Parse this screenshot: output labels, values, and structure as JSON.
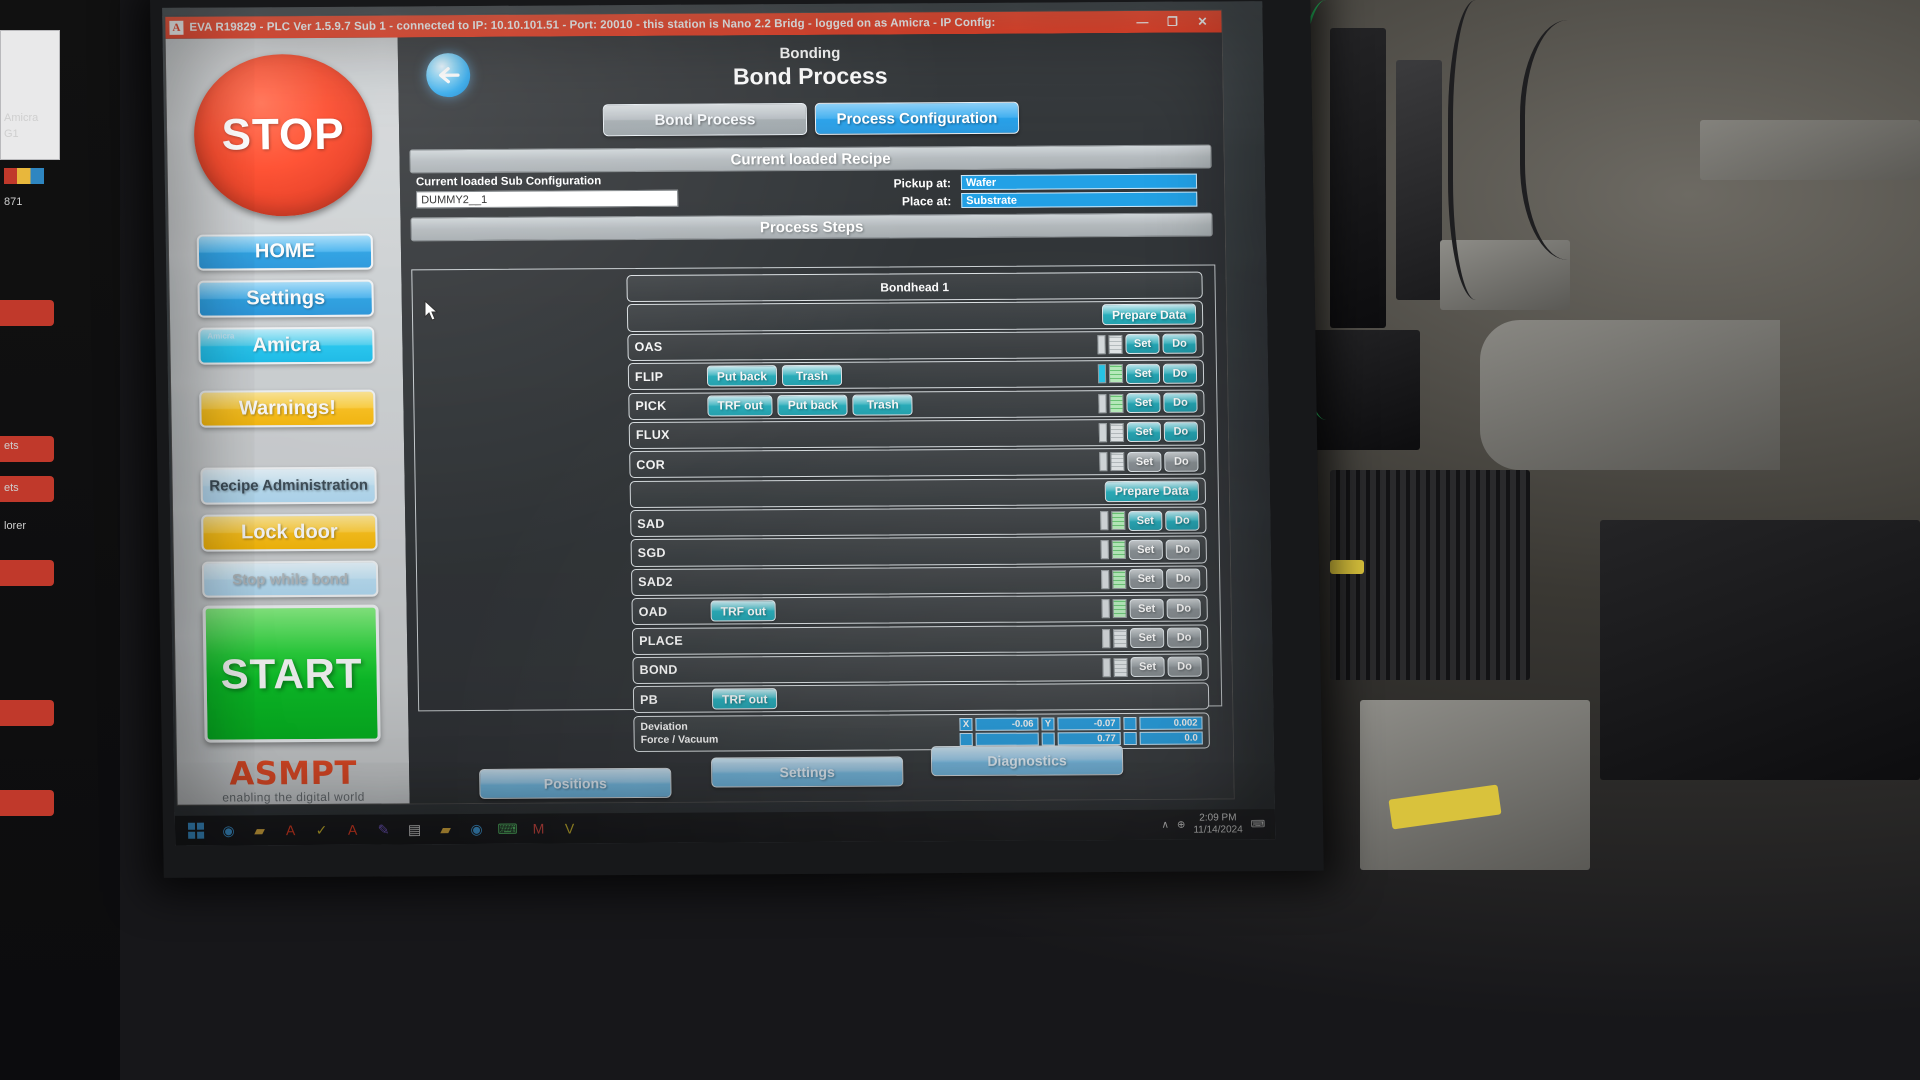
{
  "window": {
    "logo": "A",
    "title": "EVA R19829 - PLC Ver 1.5.9.7 Sub 1 - connected to IP: 10.10.101.51 - Port: 20010 - this station is Nano 2.2 Bridg - logged on as Amicra - IP Config:",
    "minimize": "—",
    "maximize": "❐",
    "close": "✕"
  },
  "sidebar": {
    "stop_label": "STOP",
    "start_label": "START",
    "buttons": [
      {
        "label": "HOME",
        "style": "b-blue",
        "tag": ""
      },
      {
        "label": "Settings",
        "style": "b-blue",
        "tag": ""
      },
      {
        "label": "Amicra",
        "style": "b-cyan",
        "tag": "Amicra"
      },
      {
        "label": "Warnings!",
        "style": "b-amber",
        "tag": ""
      },
      {
        "label": "Recipe Administration",
        "style": "b-pale",
        "tag": ""
      },
      {
        "label": "Lock door",
        "style": "b-amber",
        "tag": ""
      }
    ],
    "stop_while_label": "Stop while bond",
    "brand_name": "ASMPT",
    "brand_sub": "enabling the digital world"
  },
  "header": {
    "back_icon": "back-arrow-icon",
    "subtitle": "Bonding",
    "title": "Bond Process"
  },
  "tabs": [
    {
      "label": "Bond Process",
      "active": false
    },
    {
      "label": "Process Configuration",
      "active": true
    }
  ],
  "recipe": {
    "bar_title": "Current loaded Recipe",
    "sub_config_label": "Current loaded Sub Configuration",
    "sub_config_value": "DUMMY2__1",
    "pickup_label": "Pickup at:",
    "pickup_value": "Wafer",
    "place_label": "Place at:",
    "place_value": "Substrate"
  },
  "steps_panel": {
    "bar_title": "Process Steps",
    "bondhead_label": "Bondhead 1"
  },
  "steps": [
    {
      "name": "",
      "mid": [
        {
          "label": "Prepare Data",
          "wide": true
        }
      ],
      "slim": false,
      "grid": false,
      "set": "",
      "do": "",
      "set_style": "",
      "do_style": "",
      "controls": false
    },
    {
      "name": "OAS",
      "mid": [],
      "slim": true,
      "grid": true,
      "grid_green": false,
      "set": "Set",
      "do": "Do",
      "set_style": "sd-teal",
      "do_style": "sd-teal",
      "controls": true
    },
    {
      "name": "FLIP",
      "mid": [
        {
          "label": "Put back"
        },
        {
          "label": "Trash"
        }
      ],
      "slim": true,
      "slim_on": true,
      "grid": true,
      "grid_green": true,
      "set": "Set",
      "do": "Do",
      "set_style": "sd-teal",
      "do_style": "sd-teal",
      "controls": true
    },
    {
      "name": "PICK",
      "mid": [
        {
          "label": "TRF out"
        },
        {
          "label": "Put back"
        },
        {
          "label": "Trash"
        }
      ],
      "slim": true,
      "grid": true,
      "grid_green": true,
      "set": "Set",
      "do": "Do",
      "set_style": "sd-teal",
      "do_style": "sd-teal",
      "controls": true
    },
    {
      "name": "FLUX",
      "mid": [],
      "slim": true,
      "grid": true,
      "grid_green": false,
      "set": "Set",
      "do": "Do",
      "set_style": "sd-teal",
      "do_style": "sd-teal",
      "controls": true
    },
    {
      "name": "COR",
      "mid": [],
      "slim": true,
      "grid": true,
      "grid_green": false,
      "set": "Set",
      "do": "Do",
      "set_style": "sd-grey",
      "do_style": "sd-grey",
      "controls": true
    },
    {
      "name": "",
      "mid": [
        {
          "label": "Prepare Data",
          "wide": true
        }
      ],
      "slim": false,
      "grid": false,
      "set": "",
      "do": "",
      "set_style": "",
      "do_style": "",
      "controls": false
    },
    {
      "name": "SAD",
      "mid": [],
      "slim": true,
      "grid": true,
      "grid_green": true,
      "set": "Set",
      "do": "Do",
      "set_style": "sd-teal",
      "do_style": "sd-teal",
      "controls": true
    },
    {
      "name": "SGD",
      "mid": [],
      "slim": true,
      "grid": true,
      "grid_green": true,
      "set": "Set",
      "do": "Do",
      "set_style": "sd-grey",
      "do_style": "sd-grey",
      "controls": true
    },
    {
      "name": "SAD2",
      "mid": [],
      "slim": true,
      "grid": true,
      "grid_green": true,
      "set": "Set",
      "do": "Do",
      "set_style": "sd-grey",
      "do_style": "sd-grey",
      "controls": true
    },
    {
      "name": "OAD",
      "mid": [
        {
          "label": "TRF out"
        }
      ],
      "slim": true,
      "grid": true,
      "grid_green": true,
      "set": "Set",
      "do": "Do",
      "set_style": "sd-grey",
      "do_style": "sd-grey",
      "controls": true
    },
    {
      "name": "PLACE",
      "mid": [],
      "slim": true,
      "grid": true,
      "grid_green": false,
      "set": "Set",
      "do": "Do",
      "set_style": "sd-grey",
      "do_style": "sd-grey",
      "controls": true
    },
    {
      "name": "BOND",
      "mid": [],
      "slim": true,
      "grid": true,
      "grid_green": false,
      "set": "Set",
      "do": "Do",
      "set_style": "sd-grey",
      "do_style": "sd-grey",
      "controls": true
    },
    {
      "name": "PB",
      "mid": [
        {
          "label": "TRF out"
        }
      ],
      "slim": false,
      "grid": false,
      "set": "",
      "do": "",
      "set_style": "",
      "do_style": "",
      "controls": false
    }
  ],
  "deviation": {
    "label_1": "Deviation",
    "label_2": "Force / Vacuum",
    "row1": [
      {
        "key": "X",
        "value": "-0.06"
      },
      {
        "key": "Y",
        "value": "-0.07"
      },
      {
        "key": "",
        "value": "0.002"
      }
    ],
    "row2": [
      {
        "key": "",
        "value": ""
      },
      {
        "key": "",
        "value": "0.77"
      },
      {
        "key": "",
        "value": "0.0"
      }
    ]
  },
  "footer": [
    {
      "label": "Positions"
    },
    {
      "label": "Settings"
    },
    {
      "label": "Diagnostics"
    }
  ],
  "taskbar": {
    "start_icon": "windows-start-icon",
    "icons": [
      {
        "name": "chrome-icon",
        "glyph": "◉",
        "color": "#4aa3e0"
      },
      {
        "name": "folder-icon",
        "glyph": "▰",
        "color": "#e7b94f"
      },
      {
        "name": "app-a-icon",
        "glyph": "A",
        "color": "#e8452c"
      },
      {
        "name": "app-v-icon",
        "glyph": "✓",
        "color": "#d8c23c"
      }
    ],
    "pinned": [
      {
        "name": "app-a-red-icon",
        "glyph": "A",
        "color": "#e8452c"
      },
      {
        "name": "editor-icon",
        "glyph": "✎",
        "color": "#7a5fc7"
      },
      {
        "name": "document-icon",
        "glyph": "▤",
        "color": "#e3e3e3"
      },
      {
        "name": "explorer-icon",
        "glyph": "▰",
        "color": "#e7b94f"
      },
      {
        "name": "browser-icon",
        "glyph": "◉",
        "color": "#4aa3e0"
      },
      {
        "name": "terminal-icon",
        "glyph": "⌨",
        "color": "#5fc06f"
      },
      {
        "name": "app-m-icon",
        "glyph": "M",
        "color": "#d8514b"
      },
      {
        "name": "app-v2-icon",
        "glyph": "V",
        "color": "#d8c23c"
      }
    ],
    "tray_chevron": "∧",
    "tray_network": "⊕",
    "tray_notify": "⌨",
    "time": "2:09 PM",
    "date": "11/14/2024"
  }
}
